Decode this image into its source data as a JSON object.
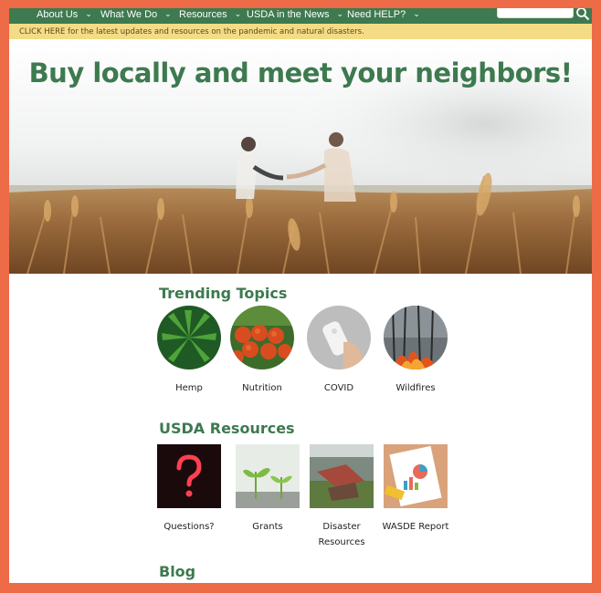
{
  "nav": {
    "items": [
      {
        "label": "About Us"
      },
      {
        "label": "What We Do"
      },
      {
        "label": "Resources"
      },
      {
        "label": "USDA in the News"
      },
      {
        "label": "Need HELP?"
      }
    ],
    "chevron": "chevron-down-icon"
  },
  "alert": {
    "text": "CLICK HERE for the latest updates and resources on the pandemic and natural disasters."
  },
  "hero": {
    "title": "Buy locally and meet your neighbors!"
  },
  "trending": {
    "title": "Trending Topics",
    "items": [
      {
        "label": "Hemp"
      },
      {
        "label": "Nutrition"
      },
      {
        "label": "COVID"
      },
      {
        "label": "Wildfires"
      }
    ]
  },
  "resources": {
    "title": "USDA Resources",
    "items": [
      {
        "label": "Questions?"
      },
      {
        "label": "Grants"
      },
      {
        "label": "Disaster Resources"
      },
      {
        "label": "WASDE Report"
      }
    ]
  },
  "blog": {
    "title": "Blog"
  },
  "colors": {
    "brand_green": "#3d7a4f",
    "alert_yellow": "#f4dc86",
    "frame_orange": "#ee6b47"
  }
}
